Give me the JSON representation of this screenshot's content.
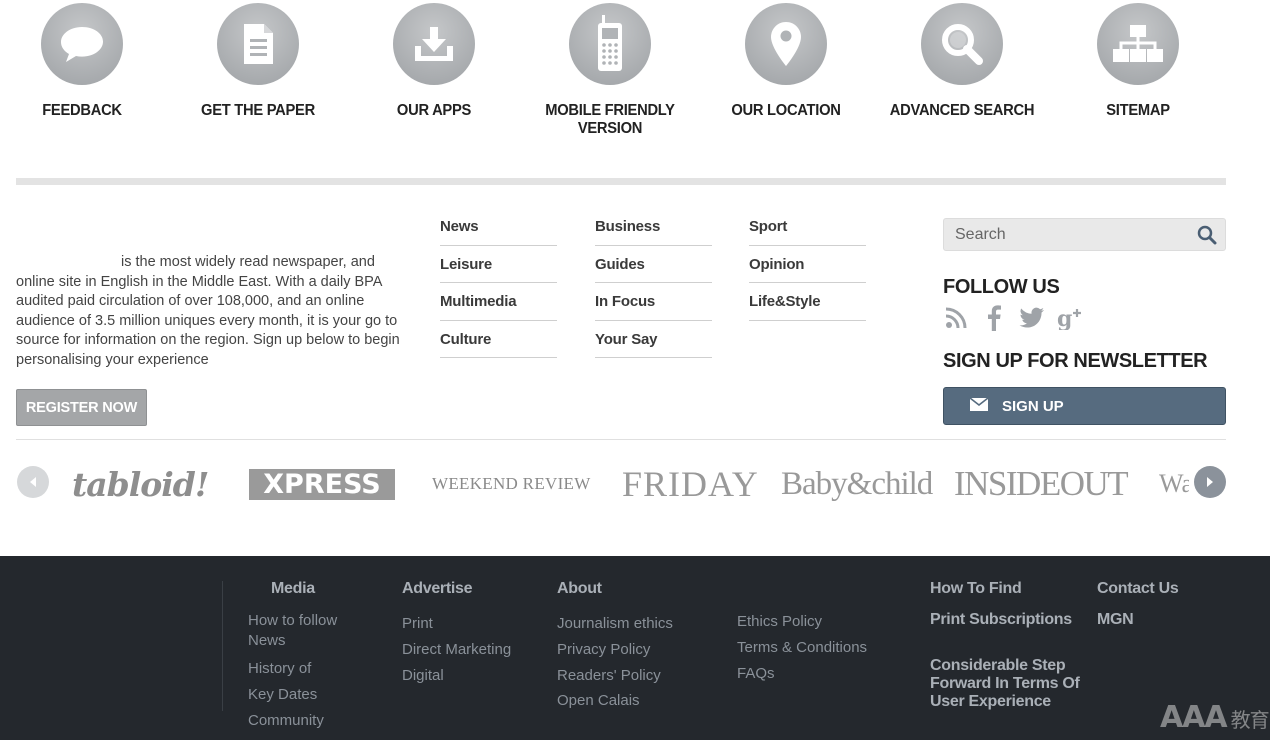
{
  "utility_links": [
    {
      "label": "FEEDBACK",
      "icon": "speech-bubble-icon"
    },
    {
      "label": "GET THE PAPER",
      "icon": "document-icon"
    },
    {
      "label": "OUR APPS",
      "icon": "download-icon"
    },
    {
      "label": "MOBILE FRIENDLY VERSION",
      "icon": "mobile-phone-icon"
    },
    {
      "label": "OUR LOCATION",
      "icon": "map-pin-icon"
    },
    {
      "label": "ADVANCED SEARCH",
      "icon": "magnifier-icon"
    },
    {
      "label": "SITEMAP",
      "icon": "sitemap-icon"
    }
  ],
  "about": {
    "text": "is the most widely read newspaper, and online site in English in the Middle East. With a daily BPA audited paid circulation of over 108,000, and an online audience of 3.5 million uniques every month, it is your go to source for information on the region. Sign up below to begin personalising your experience",
    "register_label": "REGISTER NOW"
  },
  "sections": {
    "col1": [
      "News",
      "Leisure",
      "Multimedia",
      "Culture"
    ],
    "col2": [
      "Business",
      "Guides",
      "In Focus",
      "Your Say"
    ],
    "col3": [
      "Sport",
      "Opinion",
      "Life&Style"
    ]
  },
  "search": {
    "placeholder": "Search"
  },
  "follow": {
    "title": "FOLLOW US",
    "icons": [
      "rss-icon",
      "facebook-icon",
      "twitter-icon",
      "google-plus-icon"
    ]
  },
  "newsletter": {
    "title": "SIGN UP FOR NEWSLETTER",
    "button_label": "SIGN UP"
  },
  "brands": [
    "tabloid!",
    "XPRESS",
    "WEEKEND REVIEW",
    "FRIDAY",
    "Baby&child",
    "INSIDEOUT",
    "Wat"
  ],
  "footer": {
    "media": {
      "heading": "Media",
      "links": [
        "How to follow News",
        "History of",
        "Key Dates",
        "Community"
      ]
    },
    "advertise": {
      "heading": "Advertise",
      "links": [
        "Print",
        "Direct Marketing",
        "Digital"
      ]
    },
    "about": {
      "heading": "About",
      "links": [
        "Journalism ethics",
        "Privacy Policy",
        "Readers' Policy",
        "Open Calais"
      ]
    },
    "about_more": {
      "links": [
        "Ethics Policy",
        "Terms & Conditions",
        "FAQs"
      ]
    },
    "right_col1": [
      "How To Find",
      "Print Subscriptions"
    ],
    "right_col2": [
      "Contact Us",
      "MGN"
    ],
    "tagline": "Considerable Step Forward In Terms Of User Experience"
  },
  "watermark": {
    "main": "AAA",
    "suffix": "教育"
  },
  "colors": {
    "icon_circle": "#a9acaf",
    "signup_button": "#566b7f",
    "footer_bg": "#24282d",
    "register_button": "#a4a6a8"
  }
}
